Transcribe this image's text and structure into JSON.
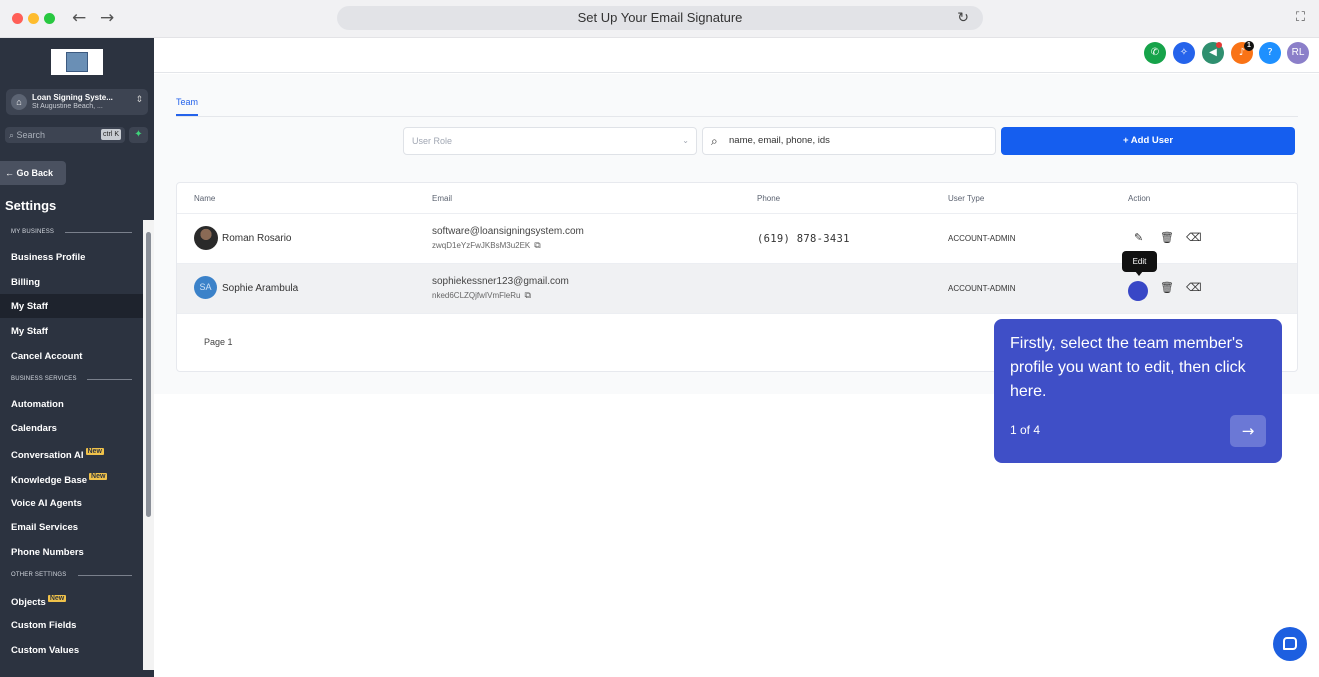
{
  "browser": {
    "title": "Set Up Your Email Signature"
  },
  "sidebar": {
    "account_name": "Loan Signing Syste...",
    "account_location": "St Augustine Beach, ...",
    "search_placeholder": "Search",
    "search_shortcut": "ctrl K",
    "go_back": "← Go Back",
    "title": "Settings",
    "sections": {
      "my_business": "MY BUSINESS",
      "business_services": "BUSINESS SERVICES",
      "other_settings": "OTHER SETTINGS"
    },
    "items": [
      {
        "label": "Business Profile"
      },
      {
        "label": "Billing"
      },
      {
        "label": "My Staff",
        "active": true
      },
      {
        "label": "My Staff"
      },
      {
        "label": "Cancel Account"
      },
      {
        "label": "Automation"
      },
      {
        "label": "Calendars"
      },
      {
        "label": "Conversation AI",
        "badge": "New"
      },
      {
        "label": "Knowledge Base",
        "badge": "New"
      },
      {
        "label": "Voice AI Agents"
      },
      {
        "label": "Email Services"
      },
      {
        "label": "Phone Numbers"
      },
      {
        "label": "Objects",
        "badge": "New"
      },
      {
        "label": "Custom Fields"
      },
      {
        "label": "Custom Values"
      }
    ]
  },
  "topbar": {
    "icons": [
      "phone-icon",
      "magic-icon",
      "megaphone-icon",
      "bell-icon",
      "help-icon"
    ],
    "notification_count": "1",
    "help_label": "?",
    "user_initials": "RL",
    "colors": {
      "phone": "#16a34a",
      "magic": "#2563eb",
      "megaphone": "#2f8f6f",
      "bell": "#f97316",
      "help": "#1e90ff",
      "user": "#8b7fc9"
    }
  },
  "main": {
    "tab": "Team",
    "role_placeholder": "User Role",
    "search_placeholder": "name, email, phone, ids",
    "add_user": "+ Add User",
    "columns": [
      "Name",
      "Email",
      "Phone",
      "User Type",
      "Action"
    ],
    "rows": [
      {
        "name": "Roman Rosario",
        "email": "software@loansigningsystem.com",
        "id": "zwqD1eYzFwJKBsM3u2EK",
        "phone": "(619) 878-3431",
        "type": "ACCOUNT-ADMIN",
        "avatar": "photo"
      },
      {
        "name": "Sophie Arambula",
        "email": "sophiekessner123@gmail.com",
        "id": "nked6CLZQjfwIVmFleRu",
        "phone": "",
        "type": "ACCOUNT-ADMIN",
        "avatar_initials": "SA"
      }
    ],
    "page_label": "Page 1"
  },
  "tooltip": {
    "label": "Edit"
  },
  "tour": {
    "text": "Firstly, select the team member's profile you want to edit, then click here.",
    "step": "1 of 4",
    "next_icon": "arrow-right-icon"
  },
  "accent": "#155eef",
  "tour_color": "#3f4fc7"
}
